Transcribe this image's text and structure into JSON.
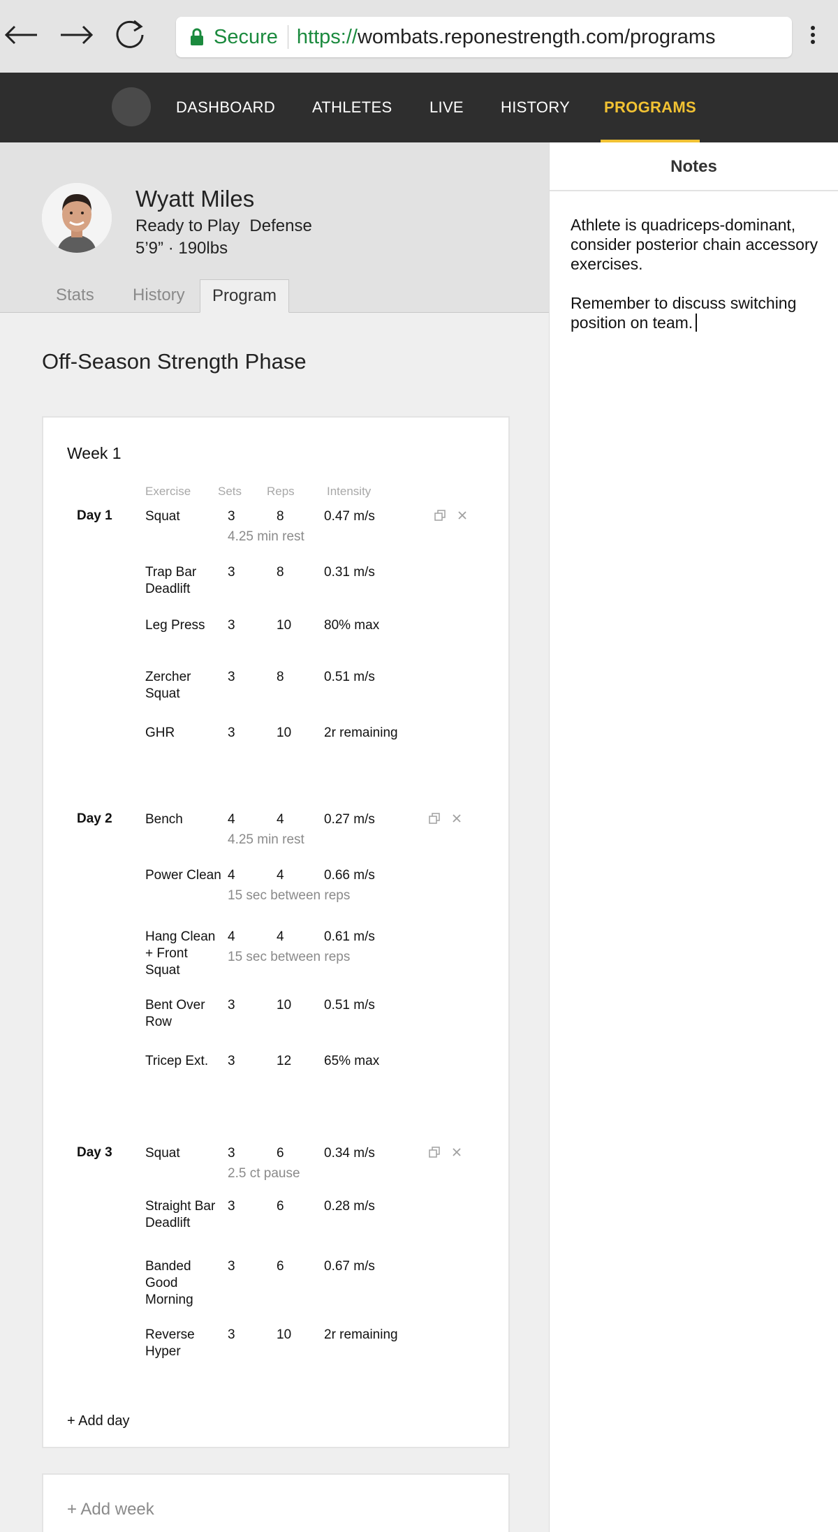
{
  "browser": {
    "secure_label": "Secure",
    "url_scheme": "https://",
    "url_host": "wombats.reponestrength.com/programs"
  },
  "nav": {
    "items": [
      {
        "label": "DASHBOARD"
      },
      {
        "label": "ATHLETES"
      },
      {
        "label": "LIVE"
      },
      {
        "label": "HISTORY"
      },
      {
        "label": "PROGRAMS"
      }
    ],
    "active": "PROGRAMS",
    "accent_color": "#f2c233"
  },
  "athlete": {
    "name": "Wyatt Miles",
    "status": "Ready to Play",
    "position": "Defense",
    "measurements": "5’9” · 190lbs"
  },
  "tabs": [
    {
      "label": "Stats"
    },
    {
      "label": "History"
    },
    {
      "label": "Program"
    }
  ],
  "active_tab": "Program",
  "program": {
    "title": "Off-Season Strength Phase",
    "week": {
      "title": "Week 1",
      "columns": {
        "exercise": "Exercise",
        "sets": "Sets",
        "reps": "Reps",
        "intensity": "Intensity"
      },
      "days": [
        {
          "label": "Day 1",
          "rows": [
            {
              "exercise": "Squat",
              "sets": "3",
              "reps": "8",
              "intensity": "0.47 m/s",
              "note": "4.25 min rest"
            },
            {
              "exercise": "Trap Bar Deadlift",
              "sets": "3",
              "reps": "8",
              "intensity": "0.31 m/s"
            },
            {
              "exercise": "Leg Press",
              "sets": "3",
              "reps": "10",
              "intensity": "80% max"
            },
            {
              "exercise": "Zercher Squat",
              "sets": "3",
              "reps": "8",
              "intensity": "0.51 m/s"
            },
            {
              "exercise": "GHR",
              "sets": "3",
              "reps": "10",
              "intensity": "2r remaining"
            }
          ]
        },
        {
          "label": "Day 2",
          "rows": [
            {
              "exercise": "Bench",
              "sets": "4",
              "reps": "4",
              "intensity": "0.27 m/s",
              "note": "4.25 min rest"
            },
            {
              "exercise": "Power Clean",
              "sets": "4",
              "reps": "4",
              "intensity": "0.66 m/s",
              "note": "15 sec between reps"
            },
            {
              "exercise": "Hang Clean + Front Squat",
              "sets": "4",
              "reps": "4",
              "intensity": "0.61 m/s",
              "note": "15 sec between reps"
            },
            {
              "exercise": "Bent Over Row",
              "sets": "3",
              "reps": "10",
              "intensity": "0.51 m/s"
            },
            {
              "exercise": "Tricep Ext.",
              "sets": "3",
              "reps": "12",
              "intensity": "65% max"
            }
          ]
        },
        {
          "label": "Day 3",
          "rows": [
            {
              "exercise": "Squat",
              "sets": "3",
              "reps": "6",
              "intensity": "0.34 m/s",
              "note": "2.5 ct pause"
            },
            {
              "exercise": "Straight Bar Deadlift",
              "sets": "3",
              "reps": "6",
              "intensity": "0.28 m/s"
            },
            {
              "exercise": "Banded Good Morning",
              "sets": "3",
              "reps": "6",
              "intensity": "0.67 m/s"
            },
            {
              "exercise": "Reverse Hyper",
              "sets": "3",
              "reps": "10",
              "intensity": "2r remaining"
            }
          ]
        }
      ],
      "add_day_label": "+ Add day"
    },
    "add_week_label": "+ Add week"
  },
  "notes": {
    "title": "Notes",
    "paragraphs": [
      "Athlete is quadriceps-dominant, consider posterior chain accessory exercises.",
      "Remember to discuss switching position on team."
    ]
  }
}
